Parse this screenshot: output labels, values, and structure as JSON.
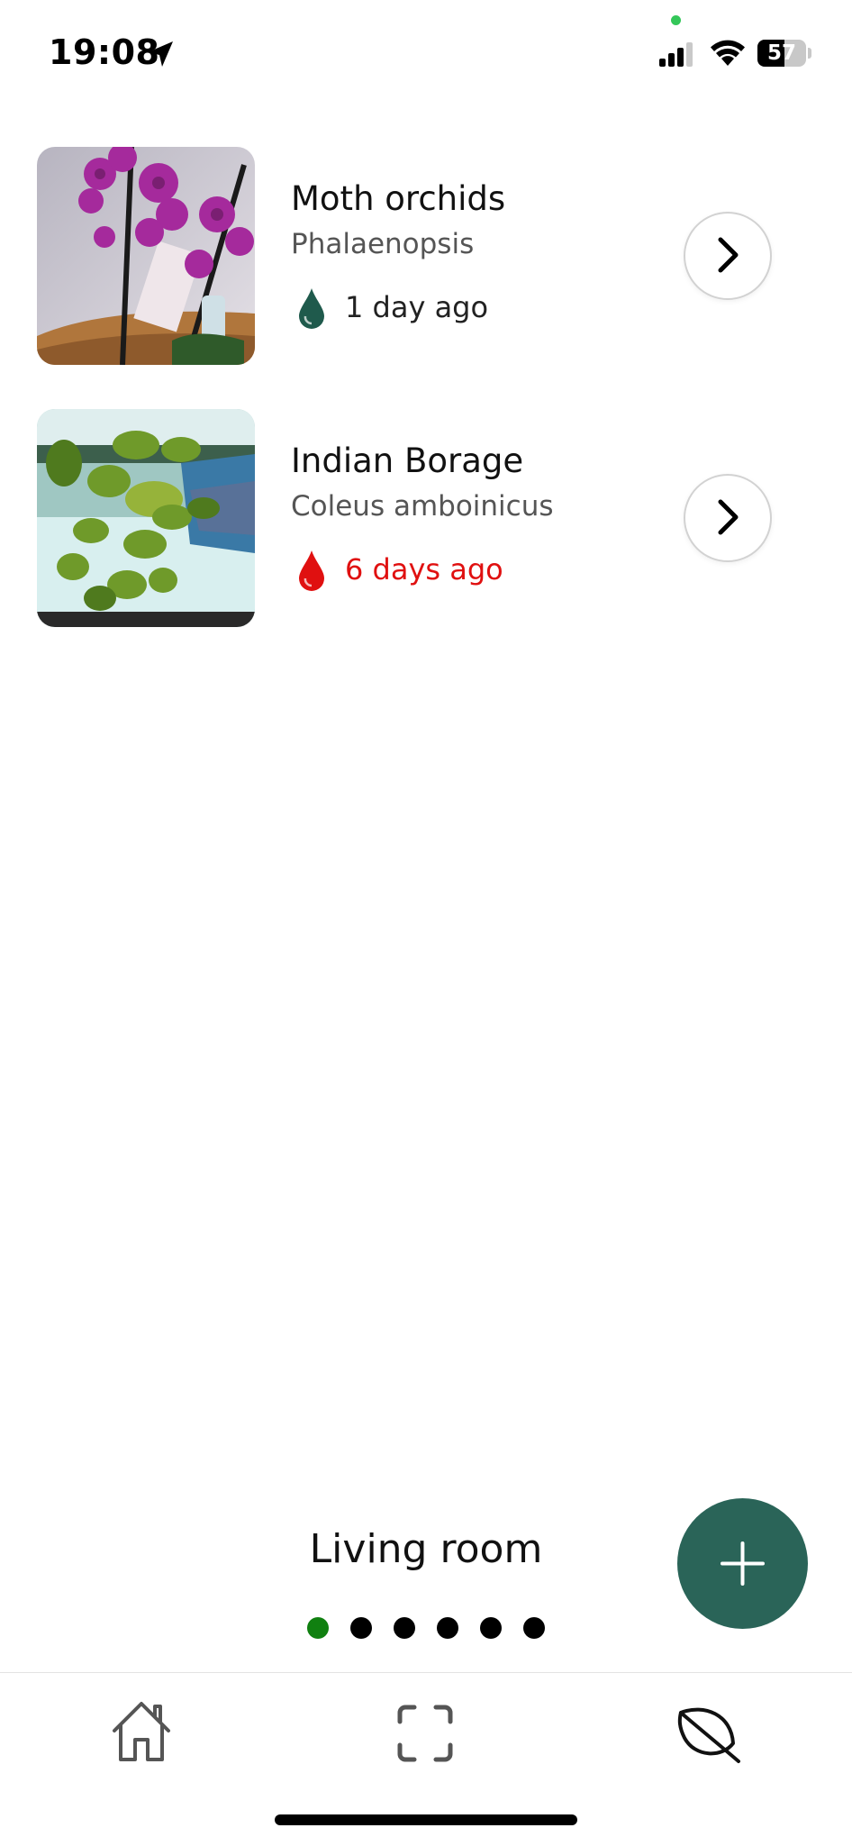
{
  "status_bar": {
    "time": "19:08",
    "battery": "57"
  },
  "plants": [
    {
      "name": "Moth orchids",
      "latin": "Phalaenopsis",
      "watered": "1 day ago",
      "status_color": "#1f5a4c"
    },
    {
      "name": "Indian Borage",
      "latin": "Coleus amboinicus",
      "watered": "6 days ago",
      "status_color": "#e01010"
    }
  ],
  "room": {
    "title": "Living room",
    "page_count": 6,
    "active_page": 1
  },
  "fab": {
    "icon": "plus-icon",
    "color": "#2a6458"
  },
  "tab_bar": {
    "items": [
      "home-icon",
      "scan-icon",
      "leaf-icon"
    ]
  }
}
